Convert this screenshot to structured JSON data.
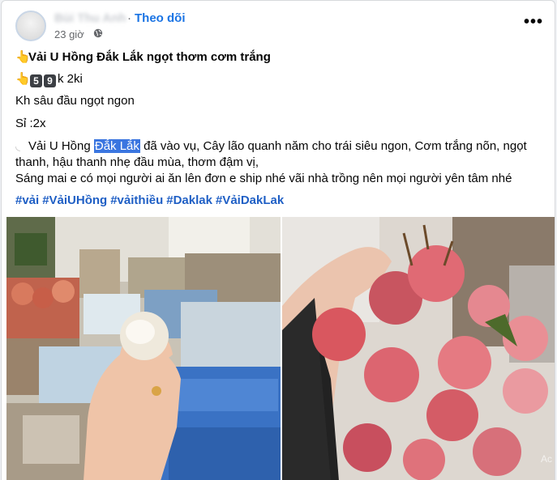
{
  "post": {
    "author": "Bùi Thu Anh",
    "follow_label": "Theo dõi",
    "timestamp": "23 giờ",
    "separator": "·",
    "more_icon": "more-horizontal-icon",
    "privacy_icon": "globe-icon",
    "lines": {
      "title": "Vải U Hồng Đắk Lắk ngọt thơm cơm trắng",
      "price_digit1": "5",
      "price_digit2": "9",
      "price_rest": "k 2ki",
      "line3": "Kh sâu đầu ngọt ngon",
      "line4": "Sỉ :2x",
      "para_before": "Vải U Hồng ",
      "para_highlight": "Đắk Lắk",
      "para_after": " đã vào vụ, Cây lão quanh năm cho trái siêu ngon, Cơm trắng nõn, ngọt",
      "para_line2": "thanh, hậu thanh nhẹ đầu mùa, thơm đậm vị,",
      "para_line3": "Sáng mai e có mọi người ai ăn lên đơn e ship nhé vãi nhà trồng nên mọi người yên tâm nhé"
    },
    "hashtags": [
      "#vải",
      "#VảiUHồng",
      "#vảithiều",
      "#Daklak",
      "#VảiDakLak"
    ],
    "photos": [
      {
        "name": "peeled lychee held in hand"
      },
      {
        "name": "lychee cluster held in hand"
      }
    ],
    "watermark": "Ac"
  },
  "colors": {
    "link": "#1b74e4",
    "hashtag": "#1f5fc5",
    "highlight": "#3b76e0",
    "muted": "#65676b"
  }
}
